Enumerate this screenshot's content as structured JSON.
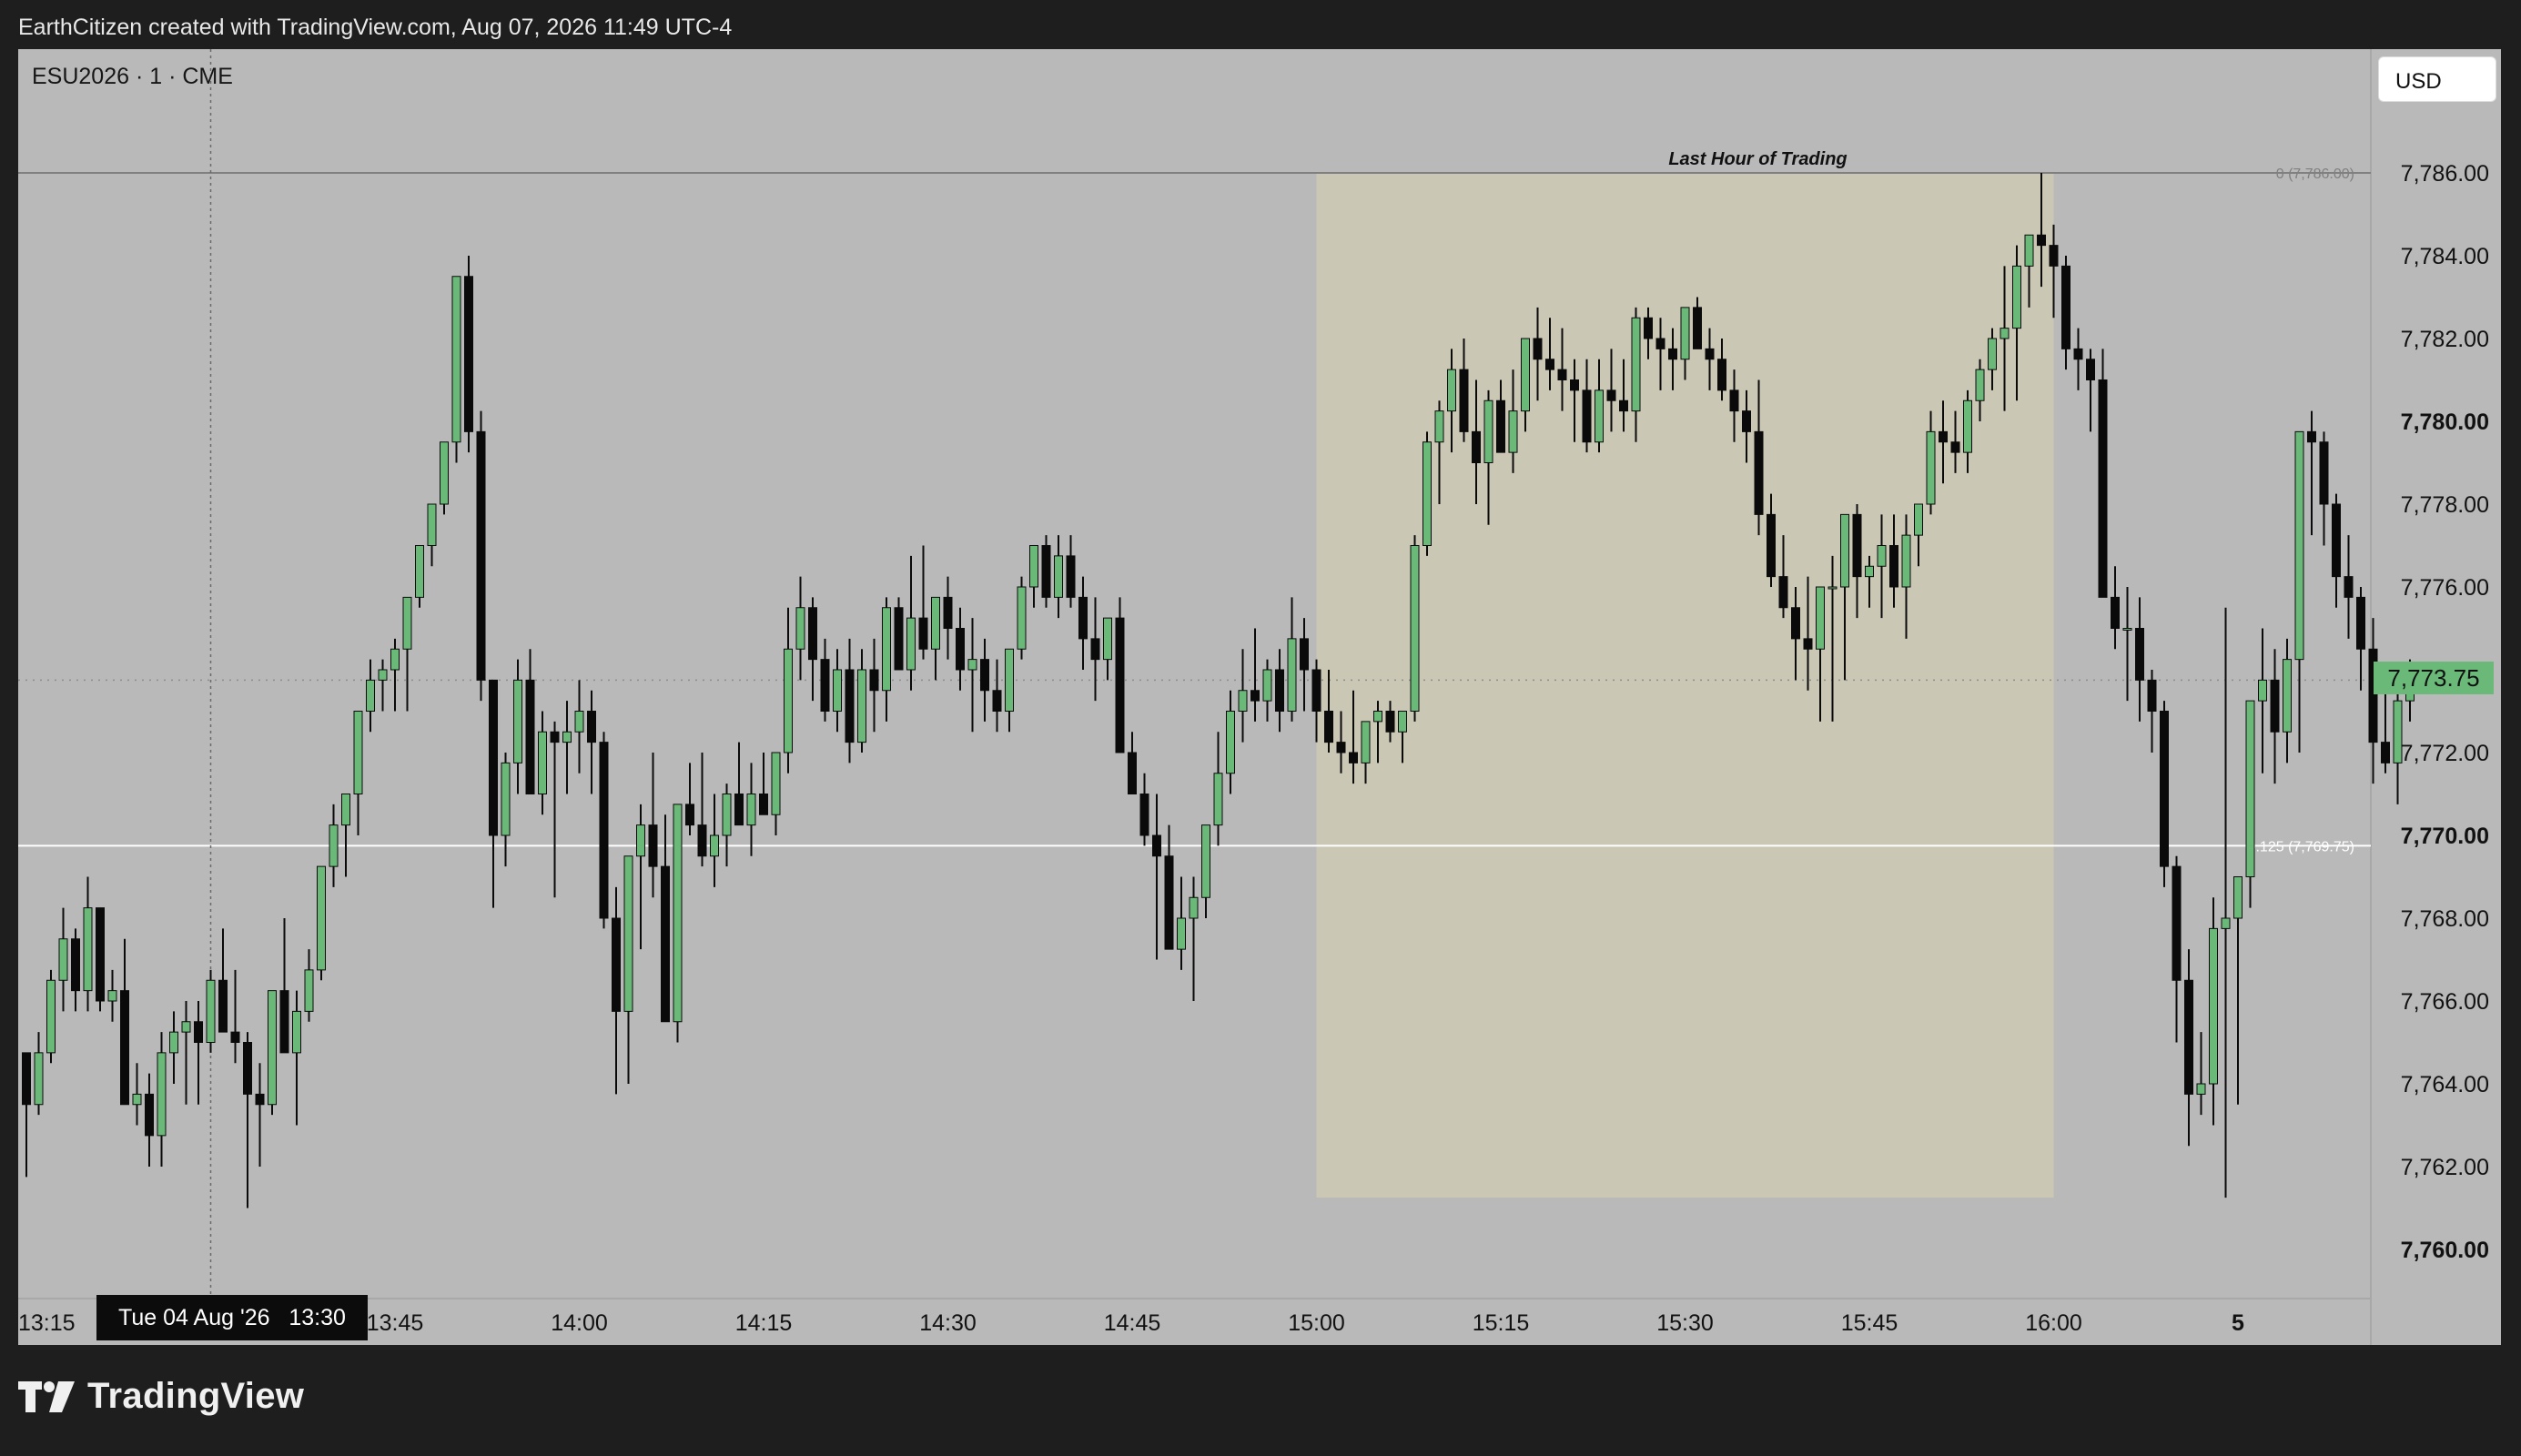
{
  "header": {
    "attribution": "EarthCitizen created with TradingView.com, Aug 07, 2026 11:49 UTC-4"
  },
  "symbol": "ESU2026 · 1 · CME",
  "currency_button": "USD",
  "last_price_label": "7,773.75",
  "crosshair_label": "Tue 04 Aug '26   13:30",
  "logo_text": "TradingView",
  "colors": {
    "up": "#6ab979",
    "down": "#0a0a0a",
    "background": "#b9b9b9",
    "highlight": "#cac7b5",
    "frame": "#1e1e1e"
  },
  "chart_data": {
    "type": "candlestick",
    "title": "",
    "x_ticks": [
      "13:15",
      "13:45",
      "14:00",
      "14:15",
      "14:30",
      "14:45",
      "15:00",
      "15:15",
      "15:30",
      "15:45",
      "16:00",
      "5"
    ],
    "x_tick_minutes": [
      0,
      30,
      45,
      60,
      75,
      90,
      105,
      120,
      135,
      150,
      165,
      180
    ],
    "y_ticks": [
      "7,760.00",
      "7,762.00",
      "7,764.00",
      "7,766.00",
      "7,768.00",
      "7,770.00",
      "7,772.00",
      "7,774.00",
      "7,776.00",
      "7,778.00",
      "7,780.00",
      "7,782.00",
      "7,784.00",
      "7,786.00"
    ],
    "y_tick_values": [
      7760,
      7762,
      7764,
      7766,
      7768,
      7770,
      7772,
      7774,
      7776,
      7778,
      7780,
      7782,
      7784,
      7786
    ],
    "ylim": [
      7759.2,
      7788.5
    ],
    "grid": false,
    "last_price": 7773.75,
    "crosshair_time": "13:30",
    "highlight": {
      "label": "Last Hour of Trading",
      "start": "15:00",
      "end": "16:00",
      "top": 7786.0,
      "bottom": 7761.25
    },
    "fib_levels": [
      {
        "label": "0 (7,786.00)",
        "value": 7786.0
      },
      {
        "label": "0.125 (7,769.75)",
        "value": 7769.75
      }
    ],
    "candles_ohlc": [
      [
        7764.75,
        7764.75,
        7761.75,
        7763.5
      ],
      [
        7763.5,
        7765.25,
        7763.25,
        7764.75
      ],
      [
        7764.75,
        7766.75,
        7764.5,
        7766.5
      ],
      [
        7766.5,
        7768.25,
        7765.75,
        7767.5
      ],
      [
        7767.5,
        7767.75,
        7765.75,
        7766.25
      ],
      [
        7766.25,
        7769.0,
        7765.75,
        7768.25
      ],
      [
        7768.25,
        7768.25,
        7765.75,
        7766.0
      ],
      [
        7766.0,
        7766.75,
        7765.5,
        7766.25
      ],
      [
        7766.25,
        7767.5,
        7764.0,
        7763.5
      ],
      [
        7763.5,
        7764.5,
        7763.0,
        7763.75
      ],
      [
        7763.75,
        7764.25,
        7762.0,
        7762.75
      ],
      [
        7762.75,
        7765.25,
        7762.0,
        7764.75
      ],
      [
        7764.75,
        7765.75,
        7764.0,
        7765.25
      ],
      [
        7765.25,
        7766.0,
        7763.5,
        7765.5
      ],
      [
        7765.5,
        7766.0,
        7763.5,
        7765.0
      ],
      [
        7765.0,
        7766.75,
        7764.75,
        7766.5
      ],
      [
        7766.5,
        7767.75,
        7765.25,
        7765.25
      ],
      [
        7765.25,
        7766.75,
        7764.5,
        7765.0
      ],
      [
        7765.0,
        7765.25,
        7761.0,
        7763.75
      ],
      [
        7763.75,
        7764.5,
        7762.0,
        7763.5
      ],
      [
        7763.5,
        7765.75,
        7763.25,
        7766.25
      ],
      [
        7766.25,
        7768.0,
        7765.25,
        7764.75
      ],
      [
        7764.75,
        7766.25,
        7763.0,
        7765.75
      ],
      [
        7765.75,
        7767.25,
        7765.5,
        7766.75
      ],
      [
        7766.75,
        7768.75,
        7766.5,
        7769.25
      ],
      [
        7769.25,
        7770.75,
        7768.75,
        7770.25
      ],
      [
        7770.25,
        7770.75,
        7769.0,
        7771.0
      ],
      [
        7771.0,
        7772.0,
        7770.0,
        7773.0
      ],
      [
        7773.0,
        7774.25,
        7772.5,
        7773.75
      ],
      [
        7773.75,
        7774.25,
        7773.0,
        7774.0
      ],
      [
        7774.0,
        7774.75,
        7773.0,
        7774.5
      ],
      [
        7774.5,
        7775.25,
        7773.0,
        7775.75
      ],
      [
        7775.75,
        7776.25,
        7775.5,
        7777.0
      ],
      [
        7777.0,
        7777.75,
        7776.5,
        7778.0
      ],
      [
        7778.0,
        7779.0,
        7777.75,
        7779.5
      ],
      [
        7779.5,
        7780.0,
        7779.0,
        7783.5
      ],
      [
        7783.5,
        7784.0,
        7779.25,
        7779.75
      ],
      [
        7779.75,
        7780.25,
        7773.25,
        7773.75
      ],
      [
        7773.75,
        7773.75,
        7768.25,
        7770.0
      ],
      [
        7770.0,
        7772.0,
        7769.25,
        7771.75
      ],
      [
        7771.75,
        7774.25,
        7771.0,
        7773.75
      ],
      [
        7773.75,
        7774.5,
        7772.5,
        7771.0
      ],
      [
        7771.0,
        7773.0,
        7770.5,
        7772.5
      ],
      [
        7772.5,
        7772.75,
        7768.5,
        7772.25
      ],
      [
        7772.25,
        7773.25,
        7771.0,
        7772.5
      ],
      [
        7772.5,
        7773.75,
        7771.5,
        7773.0
      ],
      [
        7773.0,
        7773.5,
        7771.0,
        7772.25
      ],
      [
        7772.25,
        7772.5,
        7767.75,
        7768.0
      ],
      [
        7768.0,
        7768.75,
        7763.75,
        7765.75
      ],
      [
        7765.75,
        7768.5,
        7764.0,
        7769.5
      ],
      [
        7769.5,
        7770.75,
        7767.25,
        7770.25
      ],
      [
        7770.25,
        7772.0,
        7768.5,
        7769.25
      ],
      [
        7769.25,
        7770.5,
        7768.5,
        7765.5
      ],
      [
        7765.5,
        7770.75,
        7765.0,
        7770.75
      ],
      [
        7770.75,
        7771.75,
        7770.0,
        7770.25
      ],
      [
        7770.25,
        7772.0,
        7769.25,
        7769.5
      ],
      [
        7769.5,
        7771.0,
        7768.75,
        7770.0
      ],
      [
        7770.0,
        7771.25,
        7769.25,
        7771.0
      ],
      [
        7771.0,
        7772.25,
        7770.25,
        7770.25
      ],
      [
        7770.25,
        7771.75,
        7769.5,
        7771.0
      ],
      [
        7771.0,
        7772.0,
        7770.5,
        7770.5
      ],
      [
        7770.5,
        7772.0,
        7770.0,
        7772.0
      ],
      [
        7772.0,
        7775.5,
        7771.5,
        7774.5
      ],
      [
        7774.5,
        7776.25,
        7773.75,
        7775.5
      ],
      [
        7775.5,
        7775.75,
        7773.25,
        7774.25
      ],
      [
        7774.25,
        7774.75,
        7772.75,
        7773.0
      ],
      [
        7773.0,
        7774.5,
        7772.5,
        7774.0
      ],
      [
        7774.0,
        7774.75,
        7771.75,
        7772.25
      ],
      [
        7772.25,
        7774.5,
        7772.0,
        7774.0
      ],
      [
        7774.0,
        7774.75,
        7772.5,
        7773.5
      ],
      [
        7773.5,
        7775.75,
        7772.75,
        7775.5
      ],
      [
        7775.5,
        7775.75,
        7774.25,
        7774.0
      ],
      [
        7774.0,
        7776.75,
        7773.5,
        7775.25
      ],
      [
        7775.25,
        7777.0,
        7774.25,
        7774.5
      ],
      [
        7774.5,
        7775.75,
        7773.75,
        7775.75
      ],
      [
        7775.75,
        7776.25,
        7774.25,
        7775.0
      ],
      [
        7775.0,
        7775.5,
        7773.5,
        7774.0
      ],
      [
        7774.0,
        7775.25,
        7772.5,
        7774.25
      ],
      [
        7774.25,
        7774.75,
        7772.75,
        7773.5
      ],
      [
        7773.5,
        7774.25,
        7772.5,
        7773.0
      ],
      [
        7773.0,
        7774.25,
        7772.5,
        7774.5
      ],
      [
        7774.5,
        7776.25,
        7774.25,
        7776.0
      ],
      [
        7776.0,
        7777.0,
        7775.5,
        7777.0
      ],
      [
        7777.0,
        7777.25,
        7775.5,
        7775.75
      ],
      [
        7775.75,
        7777.25,
        7775.25,
        7776.75
      ],
      [
        7776.75,
        7777.25,
        7775.5,
        7775.75
      ],
      [
        7775.75,
        7776.25,
        7774.0,
        7774.75
      ],
      [
        7774.75,
        7775.75,
        7773.25,
        7774.25
      ],
      [
        7774.25,
        7775.25,
        7773.75,
        7775.25
      ],
      [
        7775.25,
        7775.75,
        7772.25,
        7772.0
      ],
      [
        7772.0,
        7772.5,
        7771.25,
        7771.0
      ],
      [
        7771.0,
        7771.5,
        7769.75,
        7770.0
      ],
      [
        7770.0,
        7771.0,
        7767.0,
        7769.5
      ],
      [
        7769.5,
        7770.25,
        7767.5,
        7767.25
      ],
      [
        7767.25,
        7769.0,
        7766.75,
        7768.0
      ],
      [
        7768.0,
        7769.0,
        7766.0,
        7768.5
      ],
      [
        7768.5,
        7770.25,
        7768.0,
        7770.25
      ],
      [
        7770.25,
        7772.5,
        7769.75,
        7771.5
      ],
      [
        7771.5,
        7773.5,
        7771.0,
        7773.0
      ],
      [
        7773.0,
        7774.5,
        7772.25,
        7773.5
      ],
      [
        7773.5,
        7775.0,
        7772.75,
        7773.25
      ],
      [
        7773.25,
        7774.25,
        7772.75,
        7774.0
      ],
      [
        7774.0,
        7774.5,
        7772.5,
        7773.0
      ],
      [
        7773.0,
        7775.75,
        7772.75,
        7774.75
      ],
      [
        7774.75,
        7775.25,
        7773.0,
        7774.0
      ],
      [
        7774.0,
        7774.25,
        7772.25,
        7773.0
      ],
      [
        7773.0,
        7774.0,
        7772.0,
        7772.25
      ],
      [
        7772.25,
        7773.0,
        7771.5,
        7772.0
      ],
      [
        7772.0,
        7773.5,
        7771.25,
        7771.75
      ],
      [
        7771.75,
        7772.75,
        7771.25,
        7772.75
      ],
      [
        7772.75,
        7773.25,
        7771.75,
        7773.0
      ],
      [
        7773.0,
        7773.25,
        7772.25,
        7772.5
      ],
      [
        7772.5,
        7773.0,
        7771.75,
        7773.0
      ],
      [
        7773.0,
        7777.25,
        7772.75,
        7777.0
      ],
      [
        7777.0,
        7779.75,
        7776.75,
        7779.5
      ],
      [
        7779.5,
        7780.5,
        7778.0,
        7780.25
      ],
      [
        7780.25,
        7781.75,
        7779.25,
        7781.25
      ],
      [
        7781.25,
        7782.0,
        7779.5,
        7779.75
      ],
      [
        7779.75,
        7781.0,
        7778.0,
        7779.0
      ],
      [
        7779.0,
        7780.75,
        7777.5,
        7780.5
      ],
      [
        7780.5,
        7781.0,
        7779.25,
        7779.25
      ],
      [
        7779.25,
        7781.25,
        7778.75,
        7780.25
      ],
      [
        7780.25,
        7781.25,
        7779.75,
        7782.0
      ],
      [
        7782.0,
        7782.75,
        7780.5,
        7781.5
      ],
      [
        7781.5,
        7782.5,
        7780.75,
        7781.25
      ],
      [
        7781.25,
        7782.25,
        7780.25,
        7781.0
      ],
      [
        7781.0,
        7781.5,
        7779.5,
        7780.75
      ],
      [
        7780.75,
        7781.5,
        7779.25,
        7779.5
      ],
      [
        7779.5,
        7781.5,
        7779.25,
        7780.75
      ],
      [
        7780.75,
        7781.75,
        7779.75,
        7780.5
      ],
      [
        7780.5,
        7781.5,
        7779.75,
        7780.25
      ],
      [
        7780.25,
        7782.75,
        7779.5,
        7782.5
      ],
      [
        7782.5,
        7782.75,
        7781.5,
        7782.0
      ],
      [
        7782.0,
        7782.5,
        7780.75,
        7781.75
      ],
      [
        7781.75,
        7782.25,
        7780.75,
        7781.5
      ],
      [
        7781.5,
        7782.75,
        7781.0,
        7782.75
      ],
      [
        7782.75,
        7783.0,
        7781.75,
        7781.75
      ],
      [
        7781.75,
        7782.25,
        7780.75,
        7781.5
      ],
      [
        7781.5,
        7782.0,
        7780.5,
        7780.75
      ],
      [
        7780.75,
        7781.25,
        7779.5,
        7780.25
      ],
      [
        7780.25,
        7780.75,
        7779.0,
        7779.75
      ],
      [
        7779.75,
        7781.0,
        7777.25,
        7777.75
      ],
      [
        7777.75,
        7778.25,
        7776.0,
        7776.25
      ],
      [
        7776.25,
        7777.25,
        7775.25,
        7775.5
      ],
      [
        7775.5,
        7776.0,
        7773.75,
        7774.75
      ],
      [
        7774.75,
        7776.25,
        7773.5,
        7774.5
      ],
      [
        7774.5,
        7776.0,
        7772.75,
        7776.0
      ],
      [
        7776.0,
        7776.75,
        7772.75,
        7776.0
      ],
      [
        7776.0,
        7777.75,
        7773.75,
        7777.75
      ],
      [
        7777.75,
        7778.0,
        7775.25,
        7776.25
      ],
      [
        7776.25,
        7776.75,
        7775.5,
        7776.5
      ],
      [
        7776.5,
        7777.75,
        7775.25,
        7777.0
      ],
      [
        7777.0,
        7777.75,
        7775.5,
        7776.0
      ],
      [
        7776.0,
        7777.75,
        7774.75,
        7777.25
      ],
      [
        7777.25,
        7778.0,
        7776.5,
        7778.0
      ],
      [
        7778.0,
        7780.25,
        7777.75,
        7779.75
      ],
      [
        7779.75,
        7780.5,
        7778.5,
        7779.5
      ],
      [
        7779.5,
        7780.25,
        7778.75,
        7779.25
      ],
      [
        7779.25,
        7780.75,
        7778.75,
        7780.5
      ],
      [
        7780.5,
        7781.5,
        7780.0,
        7781.25
      ],
      [
        7781.25,
        7782.25,
        7780.75,
        7782.0
      ],
      [
        7782.0,
        7783.75,
        7780.25,
        7782.25
      ],
      [
        7782.25,
        7784.25,
        7780.5,
        7783.75
      ],
      [
        7783.75,
        7784.5,
        7782.75,
        7784.5
      ],
      [
        7784.5,
        7786.0,
        7783.25,
        7784.25
      ],
      [
        7784.25,
        7784.75,
        7782.5,
        7783.75
      ],
      [
        7783.75,
        7784.0,
        7781.25,
        7781.75
      ],
      [
        7781.75,
        7782.25,
        7780.75,
        7781.5
      ],
      [
        7781.5,
        7781.75,
        7779.75,
        7781.0
      ],
      [
        7781.0,
        7781.75,
        7776.0,
        7775.75
      ],
      [
        7775.75,
        7776.5,
        7774.5,
        7775.0
      ],
      [
        7775.0,
        7776.0,
        7773.25,
        7775.0
      ],
      [
        7775.0,
        7775.75,
        7772.75,
        7773.75
      ],
      [
        7773.75,
        7774.0,
        7772.0,
        7773.0
      ],
      [
        7773.0,
        7773.25,
        7768.75,
        7769.25
      ],
      [
        7769.25,
        7769.5,
        7765.0,
        7766.5
      ],
      [
        7766.5,
        7767.25,
        7762.5,
        7763.75
      ],
      [
        7763.75,
        7765.25,
        7763.25,
        7764.0
      ],
      [
        7764.0,
        7768.5,
        7763.0,
        7767.75
      ],
      [
        7767.75,
        7775.5,
        7761.25,
        7768.0
      ],
      [
        7768.0,
        7768.5,
        7763.5,
        7769.0
      ],
      [
        7769.0,
        7773.25,
        7768.25,
        7773.25
      ],
      [
        7773.25,
        7775.0,
        7771.5,
        7773.75
      ],
      [
        7773.75,
        7774.5,
        7771.25,
        7772.5
      ],
      [
        7772.5,
        7774.75,
        7771.75,
        7774.25
      ],
      [
        7774.25,
        7776.25,
        7772.0,
        7779.75
      ],
      [
        7779.75,
        7780.25,
        7777.25,
        7779.5
      ],
      [
        7779.5,
        7779.75,
        7777.0,
        7778.0
      ],
      [
        7778.0,
        7778.25,
        7775.5,
        7776.25
      ],
      [
        7776.25,
        7777.25,
        7774.75,
        7775.75
      ],
      [
        7775.75,
        7776.0,
        7773.5,
        7774.5
      ],
      [
        7774.5,
        7775.25,
        7771.25,
        7772.25
      ],
      [
        7772.25,
        7773.5,
        7771.5,
        7771.75
      ],
      [
        7771.75,
        7773.5,
        7770.75,
        7773.25
      ],
      [
        7773.25,
        7774.25,
        7772.75,
        7773.75
      ]
    ]
  }
}
